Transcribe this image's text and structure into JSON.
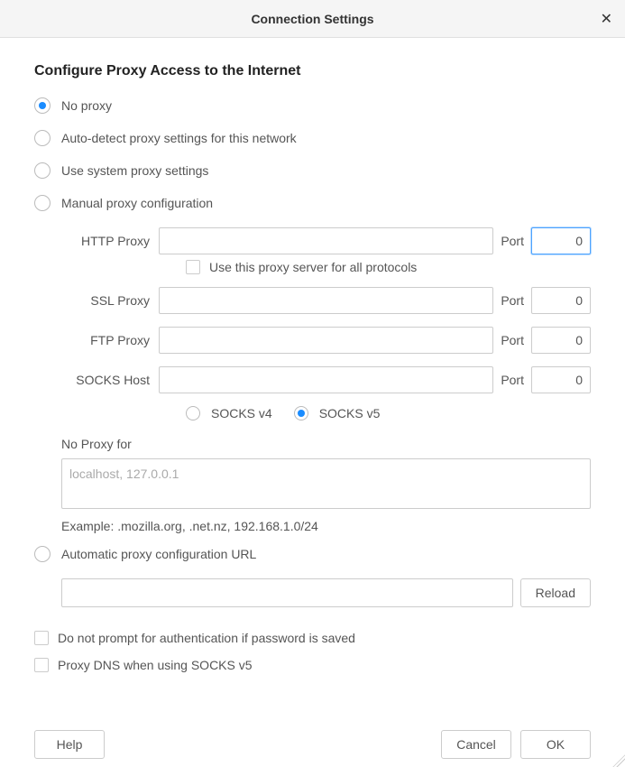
{
  "title": "Connection Settings",
  "heading": "Configure Proxy Access to the Internet",
  "radios": {
    "no_proxy": "No proxy",
    "auto_detect": "Auto-detect proxy settings for this network",
    "system": "Use system proxy settings",
    "manual": "Manual proxy configuration",
    "auto_url": "Automatic proxy configuration URL"
  },
  "labels": {
    "http_proxy": "HTTP Proxy",
    "ssl_proxy": "SSL Proxy",
    "ftp_proxy": "FTP Proxy",
    "socks_host": "SOCKS Host",
    "port": "Port",
    "use_for_all": "Use this proxy server for all protocols",
    "socks_v4": "SOCKS v4",
    "socks_v5": "SOCKS v5",
    "no_proxy_for": "No Proxy for",
    "example": "Example: .mozilla.org, .net.nz, 192.168.1.0/24",
    "reload": "Reload",
    "no_auth_prompt": "Do not prompt for authentication if password is saved",
    "proxy_dns": "Proxy DNS when using SOCKS v5"
  },
  "values": {
    "http_proxy": "",
    "http_port": "0",
    "ssl_proxy": "",
    "ssl_port": "0",
    "ftp_proxy": "",
    "ftp_port": "0",
    "socks_host": "",
    "socks_port": "0",
    "no_proxy_placeholder": "localhost, 127.0.0.1",
    "auto_url": ""
  },
  "buttons": {
    "help": "Help",
    "cancel": "Cancel",
    "ok": "OK"
  }
}
